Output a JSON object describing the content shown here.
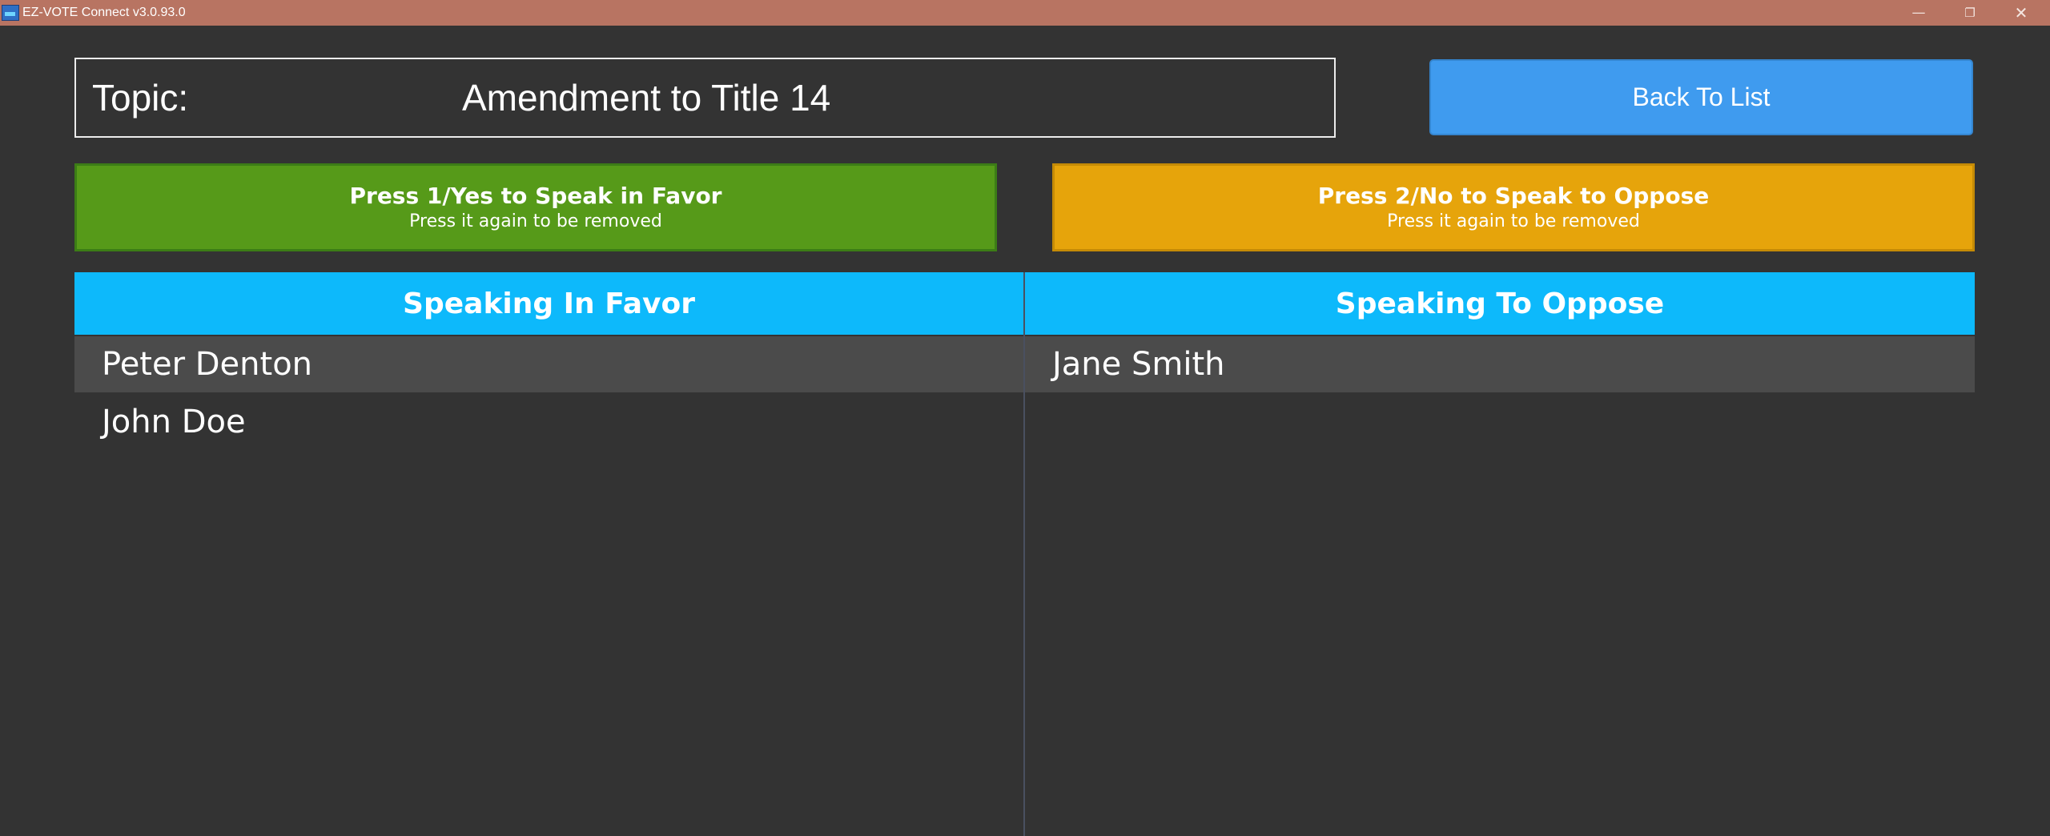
{
  "window": {
    "title": "EZ-VOTE Connect v3.0.93.0",
    "controls": {
      "minimize": "—",
      "maximize": "❐",
      "close": "✕"
    }
  },
  "topic": {
    "label": "Topic:",
    "value": "Amendment to Title 14"
  },
  "back_button": {
    "label": "Back To List"
  },
  "favor_button": {
    "main": "Press 1/Yes to Speak in Favor",
    "sub": "Press it again to be removed"
  },
  "oppose_button": {
    "main": "Press 2/No to Speak to Oppose",
    "sub": "Press it again to be removed"
  },
  "favor_list": {
    "header": "Speaking In Favor",
    "items": [
      "Peter Denton",
      "John Doe"
    ]
  },
  "oppose_list": {
    "header": "Speaking To Oppose",
    "items": [
      "Jane Smith"
    ]
  },
  "colors": {
    "titlebar": "#b87462",
    "background": "#333333",
    "favor": "#569a19",
    "oppose": "#e6a40b",
    "header": "#0db9fb",
    "back_button": "#3f9bef"
  }
}
